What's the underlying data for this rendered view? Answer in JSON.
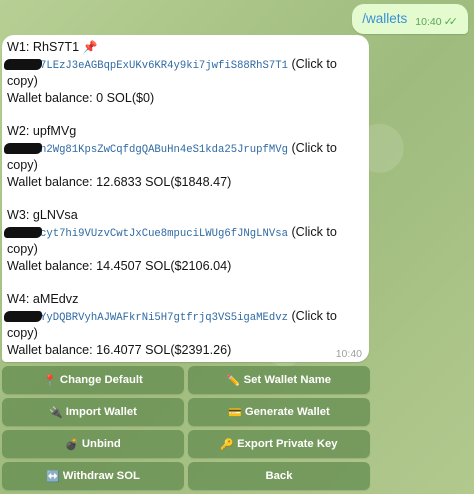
{
  "command": {
    "text": "/wallets",
    "time": "10:40"
  },
  "message": {
    "time": "10:40",
    "wallets": [
      {
        "title": "W1: RhS7T1",
        "title_icon": "pushpin-icon",
        "address": "7LEzJ3eAGBqpExUKv6KR4y9ki7jwfiS88RhS7T1",
        "click_prefix": "(Click to",
        "click_suffix": "copy)",
        "balance": "Wallet balance: 0 SOL($0)"
      },
      {
        "title": "W2: upfMVg",
        "address": "n2Wg81KpsZwCqfdgQABuHn4eS1kda25JrupfMVg",
        "click_prefix": "(Click to",
        "click_suffix": "copy)",
        "balance": "Wallet balance: 12.6833 SOL($1848.47)"
      },
      {
        "title": "W3: gLNVsa",
        "address": "cyt7hi9VUzvCwtJxCue8mpuciLWUg6fJNgLNVsa",
        "click_prefix": "(Click to",
        "click_suffix": "copy)",
        "balance": "Wallet balance: 14.4507 SOL($2106.04)"
      },
      {
        "title": "W4: aMEdvz",
        "address": "YyDQBRVyhAJWAFkrNi5H7gtfrjq3VS5igaMEdvz",
        "click_prefix": "(Click to",
        "click_suffix": "copy)",
        "balance": "Wallet balance: 16.4077 SOL($2391.26)"
      }
    ]
  },
  "keyboard": {
    "buttons": [
      {
        "label": "Change Default",
        "icon": "pushpin-icon",
        "glyph": "📍"
      },
      {
        "label": "Set Wallet Name",
        "icon": "pencil-icon",
        "glyph": "✏️"
      },
      {
        "label": "Import Wallet",
        "icon": "plug-icon",
        "glyph": "🔌"
      },
      {
        "label": "Generate Wallet",
        "icon": "card-icon",
        "glyph": "💳"
      },
      {
        "label": "Unbind",
        "icon": "bomb-icon",
        "glyph": "💣"
      },
      {
        "label": "Export Private Key",
        "icon": "key-icon",
        "glyph": "🔑"
      },
      {
        "label": "Withdraw SOL",
        "icon": "arrows-icon",
        "glyph": "↔️"
      },
      {
        "label": "Back",
        "icon": "",
        "glyph": ""
      }
    ]
  }
}
